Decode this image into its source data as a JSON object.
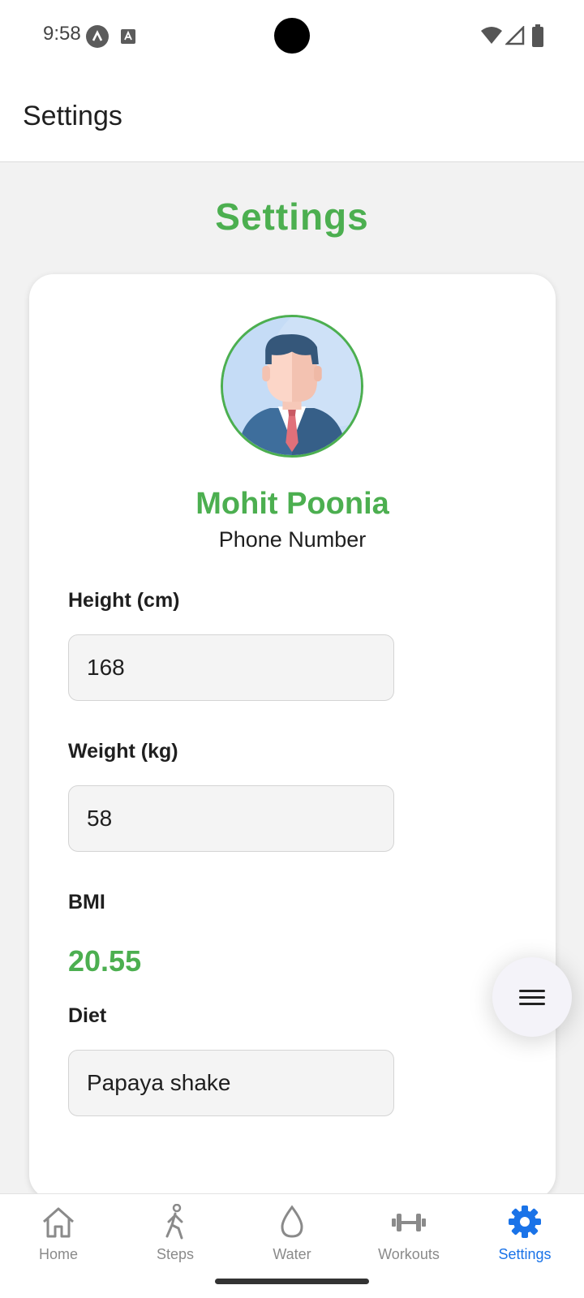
{
  "status_bar": {
    "time": "9:58"
  },
  "app_bar": {
    "title": "Settings"
  },
  "page": {
    "heading": "Settings"
  },
  "profile": {
    "name": "Mohit Poonia",
    "subtitle": "Phone Number"
  },
  "fields": {
    "height": {
      "label": "Height (cm)",
      "value": "168"
    },
    "weight": {
      "label": "Weight (kg)",
      "value": "58"
    },
    "bmi": {
      "label": "BMI",
      "value": "20.55"
    },
    "diet": {
      "label": "Diet",
      "value": "Papaya shake"
    }
  },
  "bottom_nav": {
    "items": [
      {
        "label": "Home",
        "icon": "home-icon"
      },
      {
        "label": "Steps",
        "icon": "walking-icon"
      },
      {
        "label": "Water",
        "icon": "water-drop-icon"
      },
      {
        "label": "Workouts",
        "icon": "dumbbell-icon"
      },
      {
        "label": "Settings",
        "icon": "gear-icon"
      }
    ],
    "active": "Settings"
  },
  "colors": {
    "accent_green": "#4caf50",
    "active_blue": "#1a73e8",
    "inactive_gray": "#8a8a8a"
  }
}
